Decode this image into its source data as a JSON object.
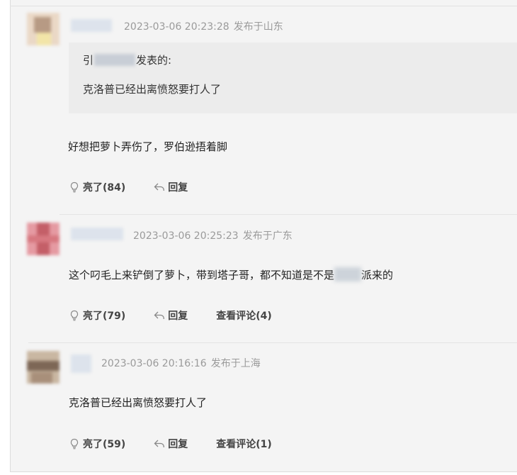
{
  "comments": [
    {
      "timestamp": "2023-03-06 20:23:28",
      "location": "发布于山东",
      "quote": {
        "prefix": "引",
        "suffix": "发表的:",
        "text": "克洛普已经出离愤怒要打人了"
      },
      "content": "好想把萝卜弄伤了，罗伯逊捂着脚",
      "light_label": "亮了(84)",
      "reply_label": "回复"
    },
    {
      "timestamp": "2023-03-06 20:25:23",
      "location": "发布于广东",
      "content_before": "这个叼毛上来铲倒了萝卜，带到塔子哥，都不知道是不是",
      "content_after": "派来的",
      "light_label": "亮了(79)",
      "reply_label": "回复",
      "view_label": "查看评论(4)"
    },
    {
      "timestamp": "2023-03-06 20:16:16",
      "location": "发布于上海",
      "content": "克洛普已经出离愤怒要打人了",
      "light_label": "亮了(59)",
      "reply_label": "回复",
      "view_label": "查看评论(1)"
    }
  ],
  "icons": {
    "light": "lightbulb-icon",
    "reply": "reply-arrow-icon"
  }
}
